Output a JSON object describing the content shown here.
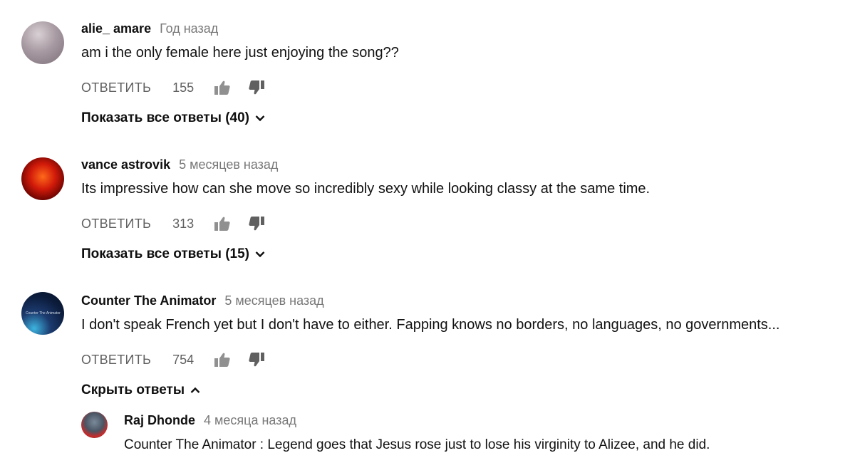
{
  "comments": [
    {
      "author": "alie_ amare",
      "time": "Год назад",
      "text": "am i the only female here just enjoying the song??",
      "reply_label": "ОТВЕТИТЬ",
      "likes": "155",
      "toggle_label": "Показать все ответы (40)"
    },
    {
      "author": "vance astrovik",
      "time": "5 месяцев назад",
      "text": "Its impressive how can she move so incredibly sexy while looking classy at the same time.",
      "reply_label": "ОТВЕТИТЬ",
      "likes": "313",
      "toggle_label": "Показать все ответы (15)"
    },
    {
      "author": "Counter The Animator",
      "time": "5 месяцев назад",
      "text": "I don't speak French yet but I don't have to either. Fapping knows no borders, no languages, no governments...",
      "reply_label": "ОТВЕТИТЬ",
      "likes": "754",
      "toggle_label": "Скрыть ответы",
      "avatar_text": "Counter The Animator"
    }
  ],
  "replies": [
    {
      "author": "Raj Dhonde",
      "time": "4 месяца назад",
      "text": "Counter The Animator : Legend goes that Jesus rose just to lose his virginity to Alizee, and he did."
    }
  ],
  "icons": {
    "like": "thumbs-up-icon",
    "dislike": "thumbs-down-icon",
    "expand": "chevron-down-icon",
    "collapse": "chevron-up-icon"
  },
  "colors": {
    "author": "#0f0f0f",
    "meta": "#606060",
    "background": "#ffffff"
  }
}
